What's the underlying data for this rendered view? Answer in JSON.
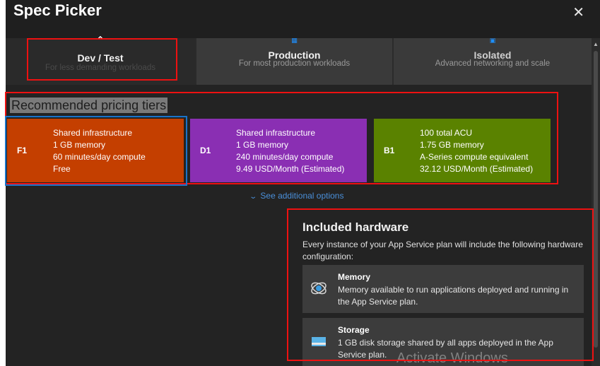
{
  "window": {
    "title": "Spec Picker",
    "close_glyph": "✕"
  },
  "tabs": [
    {
      "title": "Dev / Test",
      "subtitle": "For less demanding workloads",
      "icon": "chevron-up-icon"
    },
    {
      "title": "Production",
      "subtitle": "For most production workloads",
      "icon": "production-icon"
    },
    {
      "title": "Isolated",
      "subtitle": "Advanced networking and scale",
      "icon": "isolated-icon"
    }
  ],
  "recommended": {
    "heading": "Recommended pricing tiers",
    "tiers": [
      {
        "code": "F1",
        "color": "#c43f00",
        "lines": [
          "Shared infrastructure",
          "1 GB memory",
          "60 minutes/day compute",
          "Free"
        ]
      },
      {
        "code": "D1",
        "color": "#8a2fb3",
        "lines": [
          "Shared infrastructure",
          "1 GB memory",
          "240 minutes/day compute",
          "9.49 USD/Month (Estimated)"
        ]
      },
      {
        "code": "B1",
        "color": "#5a8200",
        "lines": [
          "100 total ACU",
          "1.75 GB memory",
          "A-Series compute equivalent",
          "32.12 USD/Month (Estimated)"
        ]
      }
    ],
    "see_more": "See additional options"
  },
  "hardware": {
    "title": "Included hardware",
    "description": "Every instance of your App Service plan will include the following hardware configuration:",
    "items": [
      {
        "title": "Memory",
        "description": "Memory available to run applications deployed and running in the App Service plan.",
        "icon": "memory-icon"
      },
      {
        "title": "Storage",
        "description": "1 GB disk storage shared by all apps deployed in the App Service plan.",
        "icon": "storage-icon"
      }
    ]
  },
  "watermark": "Activate Windows"
}
